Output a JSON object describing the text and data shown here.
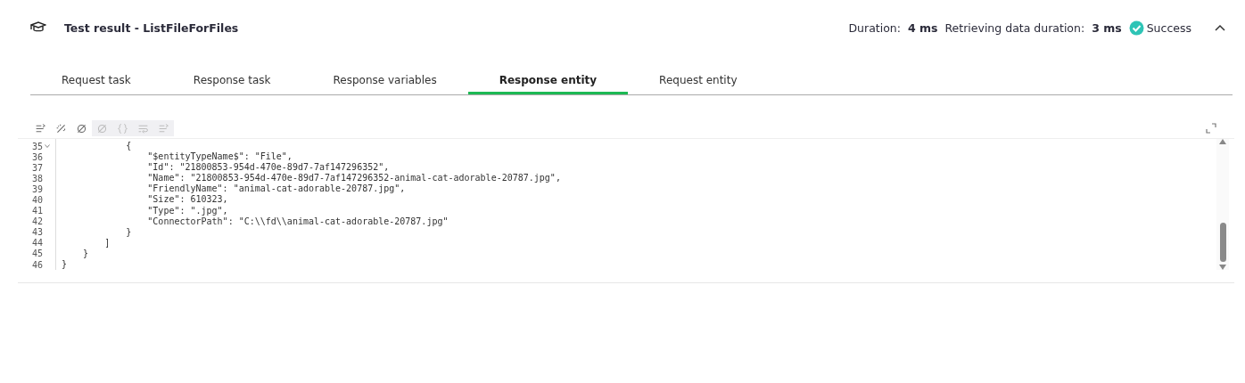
{
  "header": {
    "title": "Test result - ListFileForFiles",
    "duration_label": "Duration:",
    "duration_value": "4 ms",
    "retrieving_label": "Retrieving data duration:",
    "retrieving_value": "3 ms",
    "status": "Success",
    "expanded": true
  },
  "tabs": [
    {
      "label": "Request task",
      "selected": false
    },
    {
      "label": "Response task",
      "selected": false
    },
    {
      "label": "Response variables",
      "selected": false
    },
    {
      "label": "Response entity",
      "selected": true
    },
    {
      "label": "Request entity",
      "selected": false
    }
  ],
  "editor": {
    "toolbar": [
      {
        "kind": "lines",
        "disabled": false
      },
      {
        "kind": "wand",
        "disabled": false
      },
      {
        "kind": "slash",
        "disabled": false
      },
      {
        "kind": "slash",
        "disabled": true
      },
      {
        "kind": "braces",
        "disabled": true
      },
      {
        "kind": "wrap",
        "disabled": true
      },
      {
        "kind": "lines",
        "disabled": true
      }
    ],
    "lines": [
      {
        "number": "35",
        "text": "            {",
        "foldable": true
      },
      {
        "number": "36",
        "text": "                \"$entityTypeName$\": \"File\",",
        "foldable": false
      },
      {
        "number": "37",
        "text": "                \"Id\": \"21800853-954d-470e-89d7-7af147296352\",",
        "foldable": false
      },
      {
        "number": "38",
        "text": "                \"Name\": \"21800853-954d-470e-89d7-7af147296352-animal-cat-adorable-20787.jpg\",",
        "foldable": false
      },
      {
        "number": "39",
        "text": "                \"FriendlyName\": \"animal-cat-adorable-20787.jpg\",",
        "foldable": false
      },
      {
        "number": "40",
        "text": "                \"Size\": 610323,",
        "foldable": false
      },
      {
        "number": "41",
        "text": "                \"Type\": \".jpg\",",
        "foldable": false
      },
      {
        "number": "42",
        "text": "                \"ConnectorPath\": \"C:\\\\fd\\\\animal-cat-adorable-20787.jpg\"",
        "foldable": false
      },
      {
        "number": "43",
        "text": "            }",
        "foldable": false
      },
      {
        "number": "44",
        "text": "        ]",
        "foldable": false
      },
      {
        "number": "45",
        "text": "    }",
        "foldable": false
      },
      {
        "number": "46",
        "text": "}",
        "foldable": false
      }
    ]
  }
}
